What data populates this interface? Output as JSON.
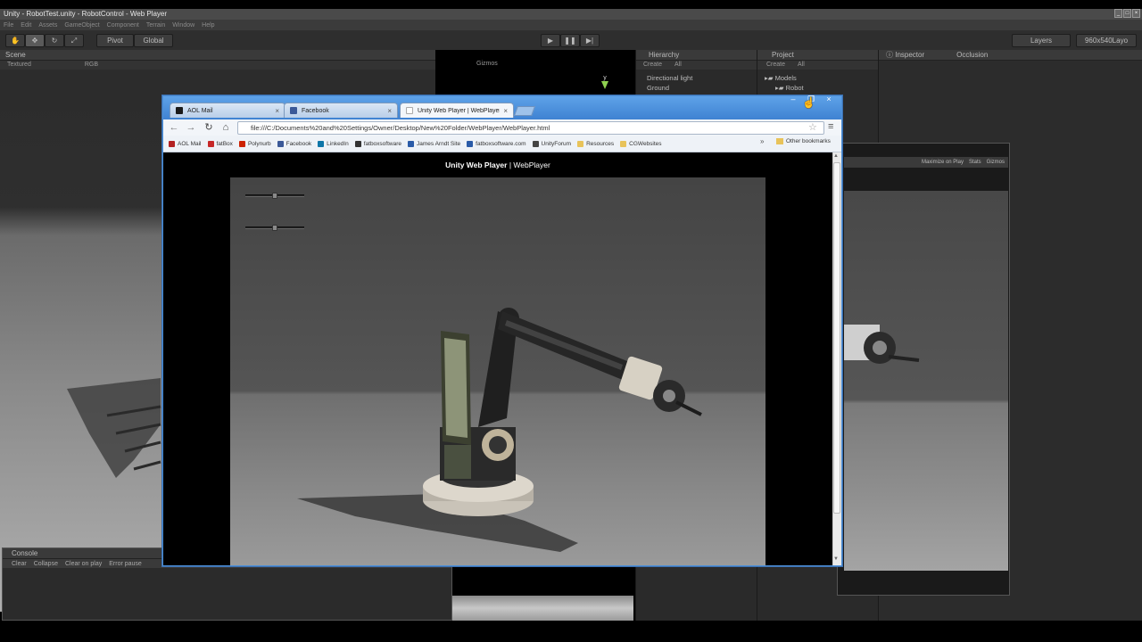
{
  "unity": {
    "title": "Unity - RobotTest.unity - RobotControl - Web Player",
    "menu": [
      "File",
      "Edit",
      "Assets",
      "GameObject",
      "Component",
      "Terrain",
      "Window",
      "Help"
    ],
    "toolbar": {
      "pivot": "Pivot",
      "global": "Global",
      "layers": "Layers",
      "layout": "960x540Layo"
    },
    "scene": {
      "tab": "Scene",
      "render_mode": "Textured",
      "color_mode": "RGB",
      "gizmos": "Gizmos",
      "all_filter": "All"
    },
    "hierarchy": {
      "tab": "Hierarchy",
      "create": "Create",
      "all_filter": "All",
      "items": [
        "Directional light",
        "Ground"
      ]
    },
    "project": {
      "tab": "Project",
      "create": "Create",
      "all_filter": "All",
      "items": [
        "Models",
        "Robot"
      ]
    },
    "inspector": {
      "tab": "Inspector",
      "occlusion": "Occlusion"
    },
    "game": {
      "maximize": "Maximize on Play",
      "stats": "Stats",
      "gizmos": "Gizmos"
    },
    "console": {
      "tab": "Console",
      "buttons": [
        "Clear",
        "Collapse",
        "Clear on play",
        "Error pause"
      ]
    },
    "gizmo_axis": "y"
  },
  "browser": {
    "tabs": [
      {
        "label": "AOL Mail",
        "color": "#1a1a1a"
      },
      {
        "label": "Facebook",
        "color": "#3b5998"
      },
      {
        "label": "Unity Web Player | WebPlayer",
        "color": "#dddddd"
      }
    ],
    "url": "file:///C:/Documents%20and%20Settings/Owner/Desktop/New%20Folder/WebPlayer/WebPlayer.html",
    "bookmarks": [
      {
        "label": "AOL Mail",
        "color": "#b32222"
      },
      {
        "label": "fatBox",
        "color": "#c62828"
      },
      {
        "label": "Polynurb",
        "color": "#cc2200"
      },
      {
        "label": "Facebook",
        "color": "#3b5998"
      },
      {
        "label": "LinkedIn",
        "color": "#0e76a8"
      },
      {
        "label": "fatboxsoftware",
        "color": "#333333"
      },
      {
        "label": "James Arndt Site",
        "color": "#2a5ba8"
      },
      {
        "label": "fatboxsoftware.com",
        "color": "#2a5ba8"
      },
      {
        "label": "UnityForum",
        "color": "#444444"
      },
      {
        "label": "Resources",
        "color": "#e8c35a"
      },
      {
        "label": "CGWebsites",
        "color": "#e8c35a"
      }
    ],
    "other_bookmarks": "Other bookmarks",
    "page_title_bold": "Unity Web Player",
    "page_title_rest": " | WebPlayer"
  },
  "sliders": [
    {
      "value": 0.5
    },
    {
      "value": 0.5
    }
  ]
}
